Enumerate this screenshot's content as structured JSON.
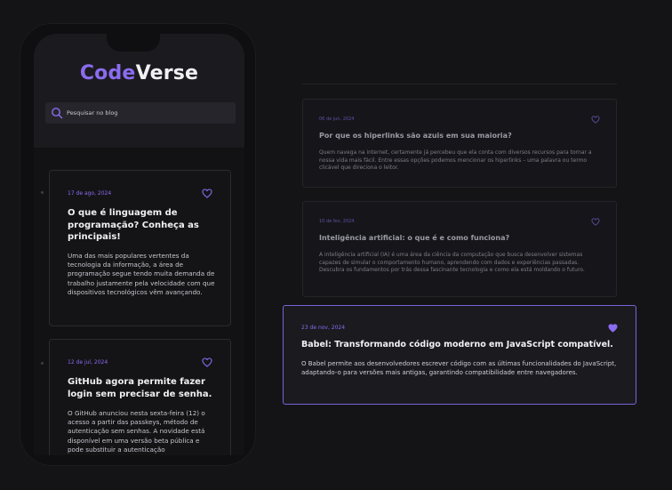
{
  "brand": {
    "part1": "Code",
    "part2": "Verse"
  },
  "search": {
    "placeholder": "Pesquisar no blog"
  },
  "mobile_posts": [
    {
      "date": "17 de ago, 2024",
      "title": "O que é linguagem de programação? Conheça as principais!",
      "description": "Uma das mais populares vertentes da tecnologia da informação, a área de programação segue tendo muita demanda de trabalho justamente pela velocidade com que dispositivos tecnológicos vêm avançando."
    },
    {
      "date": "12 de jul, 2024",
      "title": "GitHub agora permite fazer login sem precisar de senha.",
      "description": "O GitHub anunciou nesta sexta-feira (12) o acesso a partir das passkeys, método de autenticação sem senhas. A novidade está disponível em uma versão beta pública e pode substituir a autenticação"
    }
  ],
  "desktop_posts": [
    {
      "date": "06 de jun, 2024",
      "title": "Por que os hiperlinks são azuis em sua maioria?",
      "description": "Quem navega na internet, certamente já percebeu que ela conta com diversos recursos para tornar a nossa vida mais fácil. Entre essas opções podemos mencionar os hiperlinks – uma palavra ou termo clicável que direciona o leitor."
    },
    {
      "date": "10 de fev, 2024",
      "title": "Inteligência artificial: o que é e como funciona?",
      "description": "A inteligência artificial (IA) é uma área da ciência da computação que busca desenvolver sistemas capazes de simular o comportamento humano, aprendendo com dados e experiências passadas. Descubra os fundamentos por trás dessa fascinante tecnologia e como ela está moldando o futuro."
    },
    {
      "date": "23 de nov, 2024",
      "title": "Babel: Transformando código moderno em JavaScript compatível.",
      "description": "O Babel permite aos desenvolvedores escrever código com as últimas funcionalidades do JavaScript, adaptando-o para versões mais antigas, garantindo compatibilidade entre navegadores.",
      "favorited": true
    }
  ],
  "colors": {
    "accent": "#8b6cf0",
    "background": "#141416",
    "card": "#16161a"
  },
  "icons": {
    "search": "search-icon",
    "favorite": "heart-icon"
  }
}
